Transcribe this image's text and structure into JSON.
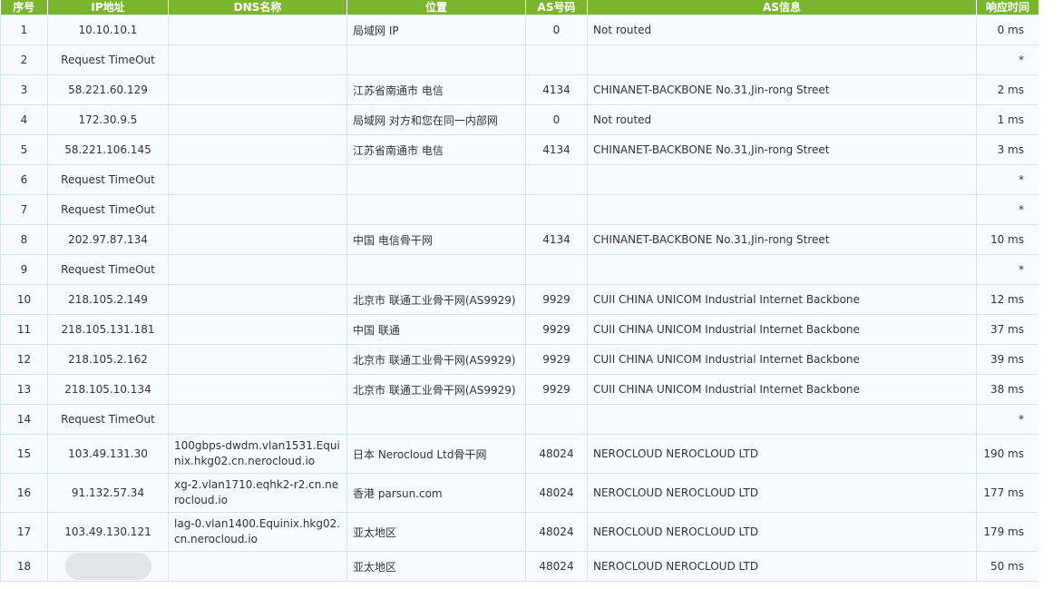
{
  "headers": [
    "序号",
    "IP地址",
    "DNS名称",
    "位置",
    "AS号码",
    "AS信息",
    "响应时间"
  ],
  "rows": [
    {
      "num": "1",
      "ip": "10.10.10.1",
      "dns": "",
      "loc": "局域网 IP",
      "as": "0",
      "info": "Not routed",
      "time": "0 ms"
    },
    {
      "num": "2",
      "ip": "Request TimeOut",
      "dns": "",
      "loc": "",
      "as": "",
      "info": "",
      "time": "*"
    },
    {
      "num": "3",
      "ip": "58.221.60.129",
      "dns": "",
      "loc": "江苏省南通市 电信",
      "as": "4134",
      "info": "CHINANET-BACKBONE No.31,Jin-rong Street",
      "time": "2 ms"
    },
    {
      "num": "4",
      "ip": "172.30.9.5",
      "dns": "",
      "loc": "局域网 对方和您在同一内部网",
      "as": "0",
      "info": "Not routed",
      "time": "1 ms"
    },
    {
      "num": "5",
      "ip": "58.221.106.145",
      "dns": "",
      "loc": "江苏省南通市 电信",
      "as": "4134",
      "info": "CHINANET-BACKBONE No.31,Jin-rong Street",
      "time": "3 ms"
    },
    {
      "num": "6",
      "ip": "Request TimeOut",
      "dns": "",
      "loc": "",
      "as": "",
      "info": "",
      "time": "*"
    },
    {
      "num": "7",
      "ip": "Request TimeOut",
      "dns": "",
      "loc": "",
      "as": "",
      "info": "",
      "time": "*"
    },
    {
      "num": "8",
      "ip": "202.97.87.134",
      "dns": "",
      "loc": "中国 电信骨干网",
      "as": "4134",
      "info": "CHINANET-BACKBONE No.31,Jin-rong Street",
      "time": "10 ms"
    },
    {
      "num": "9",
      "ip": "Request TimeOut",
      "dns": "",
      "loc": "",
      "as": "",
      "info": "",
      "time": "*"
    },
    {
      "num": "10",
      "ip": "218.105.2.149",
      "dns": "",
      "loc": "北京市 联通工业骨干网(AS9929)",
      "as": "9929",
      "info": "CUII CHINA UNICOM Industrial Internet Backbone",
      "time": "12 ms"
    },
    {
      "num": "11",
      "ip": "218.105.131.181",
      "dns": "",
      "loc": "中国 联通",
      "as": "9929",
      "info": "CUII CHINA UNICOM Industrial Internet Backbone",
      "time": "37 ms"
    },
    {
      "num": "12",
      "ip": "218.105.2.162",
      "dns": "",
      "loc": "北京市 联通工业骨干网(AS9929)",
      "as": "9929",
      "info": "CUII CHINA UNICOM Industrial Internet Backbone",
      "time": "39 ms"
    },
    {
      "num": "13",
      "ip": "218.105.10.134",
      "dns": "",
      "loc": "北京市 联通工业骨干网(AS9929)",
      "as": "9929",
      "info": "CUII CHINA UNICOM Industrial Internet Backbone",
      "time": "38 ms"
    },
    {
      "num": "14",
      "ip": "Request TimeOut",
      "dns": "",
      "loc": "",
      "as": "",
      "info": "",
      "time": "*"
    },
    {
      "num": "15",
      "ip": "103.49.131.30",
      "dns": "100gbps-dwdm.vlan1531.Equinix.hkg02.cn.nerocloud.io",
      "loc": "日本 Nerocloud Ltd骨干网",
      "as": "48024",
      "info": "NEROCLOUD NEROCLOUD LTD",
      "time": "190 ms"
    },
    {
      "num": "16",
      "ip": "91.132.57.34",
      "dns": "xg-2.vlan1710.eqhk2-r2.cn.nerocloud.io",
      "loc": "香港 parsun.com",
      "as": "48024",
      "info": "NEROCLOUD NEROCLOUD LTD",
      "time": "177 ms"
    },
    {
      "num": "17",
      "ip": "103.49.130.121",
      "dns": "lag-0.vlan1400.Equinix.hkg02.cn.nerocloud.io",
      "loc": "亚太地区",
      "as": "48024",
      "info": "NEROCLOUD NEROCLOUD LTD",
      "time": "179 ms"
    },
    {
      "num": "18",
      "ip": "",
      "dns": "",
      "loc": "亚太地区",
      "as": "48024",
      "info": "NEROCLOUD NEROCLOUD LTD",
      "time": "50 ms"
    }
  ]
}
